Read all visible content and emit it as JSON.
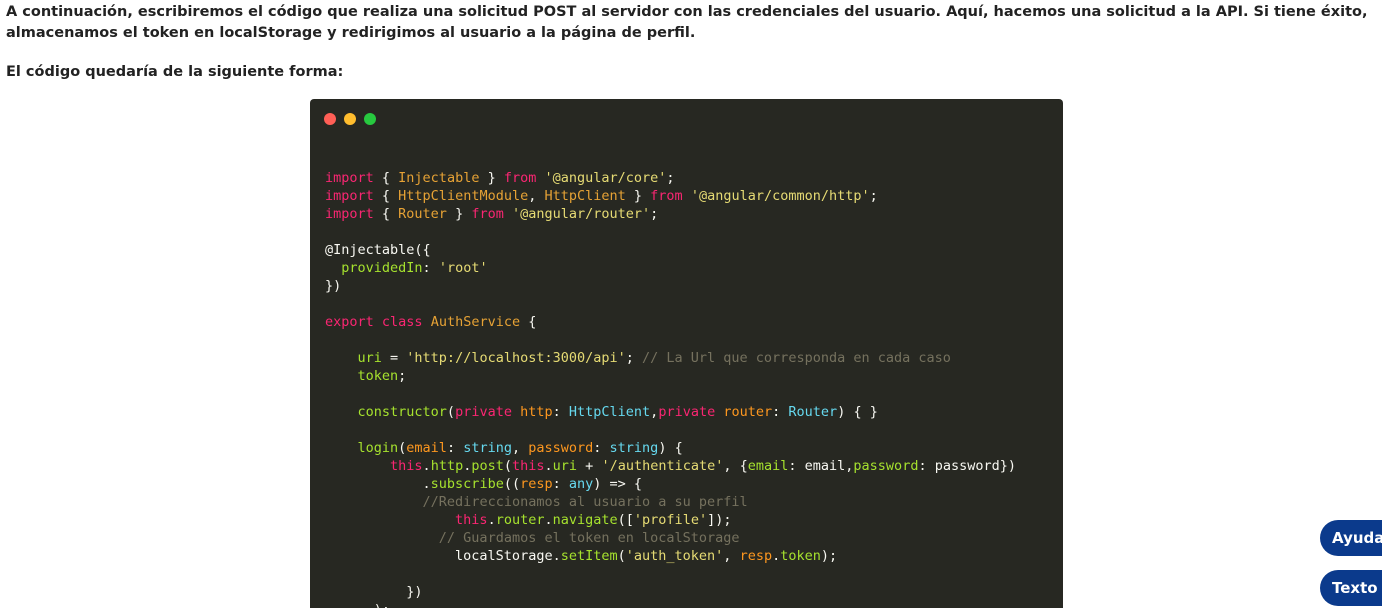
{
  "article": {
    "paragraph_1": "A continuación, escribiremos el código que realiza una solicitud POST al servidor con las credenciales del usuario. Aquí, hacemos una solicitud a la API. Si tiene éxito, almacenamos el token en localStorage y redirigimos al usuario a la página de perfil.",
    "paragraph_2": "El código quedaría de la siguiente forma:"
  },
  "code_window": {
    "dot_colors": [
      "#ff5f56",
      "#ffbd2e",
      "#27c93f"
    ],
    "lines": [
      [],
      [
        [
          "keyword",
          "import"
        ],
        [
          "plain",
          " { "
        ],
        [
          "class",
          "Injectable"
        ],
        [
          "plain",
          " } "
        ],
        [
          "keyword",
          "from"
        ],
        [
          "plain",
          " "
        ],
        [
          "string",
          "'@angular/core'"
        ],
        [
          "plain",
          ";"
        ]
      ],
      [
        [
          "keyword",
          "import"
        ],
        [
          "plain",
          " { "
        ],
        [
          "class",
          "HttpClientModule"
        ],
        [
          "plain",
          ", "
        ],
        [
          "class",
          "HttpClient"
        ],
        [
          "plain",
          " } "
        ],
        [
          "keyword",
          "from"
        ],
        [
          "plain",
          " "
        ],
        [
          "string",
          "'@angular/common/http'"
        ],
        [
          "plain",
          ";"
        ]
      ],
      [
        [
          "keyword",
          "import"
        ],
        [
          "plain",
          " { "
        ],
        [
          "class",
          "Router"
        ],
        [
          "plain",
          " } "
        ],
        [
          "keyword",
          "from"
        ],
        [
          "plain",
          " "
        ],
        [
          "string",
          "'@angular/router'"
        ],
        [
          "plain",
          ";"
        ]
      ],
      [],
      [
        [
          "plain",
          "@Injectable({"
        ]
      ],
      [
        [
          "plain",
          "  "
        ],
        [
          "func",
          "providedIn"
        ],
        [
          "plain",
          ": "
        ],
        [
          "string",
          "'root'"
        ]
      ],
      [
        [
          "plain",
          "})"
        ]
      ],
      [],
      [
        [
          "keyword",
          "export"
        ],
        [
          "plain",
          " "
        ],
        [
          "keyword",
          "class"
        ],
        [
          "plain",
          " "
        ],
        [
          "class",
          "AuthService"
        ],
        [
          "plain",
          " {"
        ]
      ],
      [],
      [
        [
          "plain",
          "    "
        ],
        [
          "func",
          "uri"
        ],
        [
          "plain",
          " = "
        ],
        [
          "string",
          "'http://localhost:3000/api'"
        ],
        [
          "plain",
          "; "
        ],
        [
          "comment",
          "// La Url que corresponda en cada caso"
        ]
      ],
      [
        [
          "plain",
          "    "
        ],
        [
          "func",
          "token"
        ],
        [
          "plain",
          ";"
        ]
      ],
      [],
      [
        [
          "plain",
          "    "
        ],
        [
          "func",
          "constructor"
        ],
        [
          "plain",
          "("
        ],
        [
          "keyword",
          "private"
        ],
        [
          "plain",
          " "
        ],
        [
          "param",
          "http"
        ],
        [
          "plain",
          ": "
        ],
        [
          "type",
          "HttpClient"
        ],
        [
          "plain",
          ","
        ],
        [
          "keyword",
          "private"
        ],
        [
          "plain",
          " "
        ],
        [
          "param",
          "router"
        ],
        [
          "plain",
          ": "
        ],
        [
          "type",
          "Router"
        ],
        [
          "plain",
          ") { }"
        ]
      ],
      [],
      [
        [
          "plain",
          "    "
        ],
        [
          "func",
          "login"
        ],
        [
          "plain",
          "("
        ],
        [
          "param",
          "email"
        ],
        [
          "plain",
          ": "
        ],
        [
          "type",
          "string"
        ],
        [
          "plain",
          ", "
        ],
        [
          "param",
          "password"
        ],
        [
          "plain",
          ": "
        ],
        [
          "type",
          "string"
        ],
        [
          "plain",
          ") {"
        ]
      ],
      [
        [
          "plain",
          "        "
        ],
        [
          "keyword",
          "this"
        ],
        [
          "plain",
          "."
        ],
        [
          "func",
          "http"
        ],
        [
          "plain",
          "."
        ],
        [
          "func",
          "post"
        ],
        [
          "plain",
          "("
        ],
        [
          "keyword",
          "this"
        ],
        [
          "plain",
          "."
        ],
        [
          "func",
          "uri"
        ],
        [
          "plain",
          " + "
        ],
        [
          "string",
          "'/authenticate'"
        ],
        [
          "plain",
          ", {"
        ],
        [
          "func",
          "email"
        ],
        [
          "plain",
          ": email,"
        ],
        [
          "func",
          "password"
        ],
        [
          "plain",
          ": password})"
        ]
      ],
      [
        [
          "plain",
          "            ."
        ],
        [
          "func",
          "subscribe"
        ],
        [
          "plain",
          "(("
        ],
        [
          "param",
          "resp"
        ],
        [
          "plain",
          ": "
        ],
        [
          "type",
          "any"
        ],
        [
          "plain",
          ") => {"
        ]
      ],
      [
        [
          "plain",
          "            "
        ],
        [
          "comment",
          "//Redireccionamos al usuario a su perfil"
        ]
      ],
      [
        [
          "plain",
          "                "
        ],
        [
          "keyword",
          "this"
        ],
        [
          "plain",
          "."
        ],
        [
          "func",
          "router"
        ],
        [
          "plain",
          "."
        ],
        [
          "func",
          "navigate"
        ],
        [
          "plain",
          "(["
        ],
        [
          "string",
          "'profile'"
        ],
        [
          "plain",
          "]);"
        ]
      ],
      [
        [
          "plain",
          "              "
        ],
        [
          "comment",
          "// Guardamos el token en localStorage"
        ]
      ],
      [
        [
          "plain",
          "                localStorage."
        ],
        [
          "func",
          "setItem"
        ],
        [
          "plain",
          "("
        ],
        [
          "string",
          "'auth_token'"
        ],
        [
          "plain",
          ", "
        ],
        [
          "param",
          "resp"
        ],
        [
          "plain",
          "."
        ],
        [
          "func",
          "token"
        ],
        [
          "plain",
          ");"
        ]
      ],
      [],
      [
        [
          "plain",
          "          })"
        ]
      ],
      [
        [
          "plain",
          "      );"
        ]
      ]
    ]
  },
  "floating_buttons": {
    "help_label": "Ayuda",
    "text_label": "Texto a voz"
  }
}
